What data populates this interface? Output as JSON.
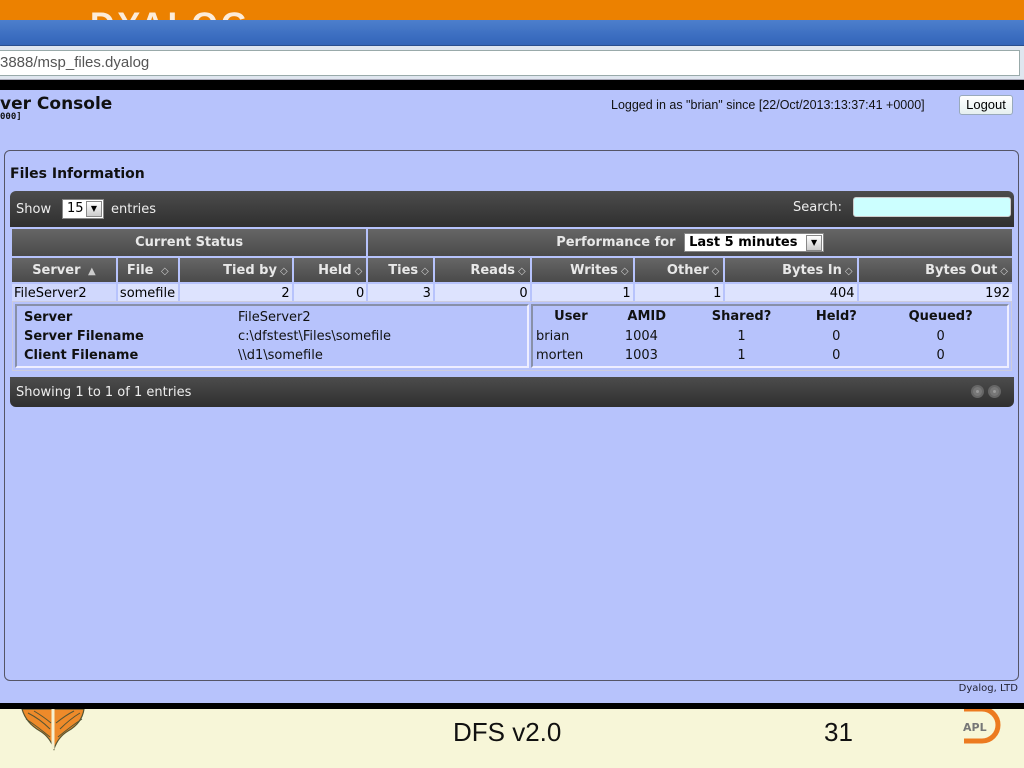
{
  "slide": {
    "brand": "DYALOG",
    "footer_title": "DFS v2.0",
    "page_number": "31",
    "apl_logo_text": "APL",
    "colors": {
      "banner": "#ec8100",
      "footer_bg": "#f7f6d8"
    }
  },
  "browser": {
    "address": "3888/msp_files.dyalog"
  },
  "page": {
    "title": "ver Console",
    "subtitle": "000]",
    "login_info": "Logged in as \"brian\" since [22/Oct/2013:13:37:41 +0000]",
    "logout_label": "Logout",
    "credits": "Dyalog, LTD",
    "background": "#b7c3fc"
  },
  "files_panel": {
    "title": "Files Information",
    "show_label": "Show",
    "page_length": "15",
    "entries_label": "entries",
    "search_label": "Search:",
    "search_value": "",
    "group_headers": {
      "current_status": "Current Status",
      "performance_for": "Performance for",
      "performance_period": "Last 5 minutes"
    },
    "columns": [
      {
        "label": "Server",
        "sort": "▲"
      },
      {
        "label": "File",
        "sort": "◇"
      },
      {
        "label": "Tied by",
        "sort": "◇"
      },
      {
        "label": "Held",
        "sort": "◇"
      },
      {
        "label": "Ties",
        "sort": "◇"
      },
      {
        "label": "Reads",
        "sort": "◇"
      },
      {
        "label": "Writes",
        "sort": "◇"
      },
      {
        "label": "Other",
        "sort": "◇"
      },
      {
        "label": "Bytes In",
        "sort": "◇"
      },
      {
        "label": "Bytes Out",
        "sort": "◇"
      }
    ],
    "rows": [
      {
        "server": "FileServer2",
        "file": "somefile",
        "tied_by": "2",
        "held": "0",
        "ties": "3",
        "reads": "0",
        "writes": "1",
        "other": "1",
        "bytes_in": "404",
        "bytes_out": "192"
      }
    ],
    "details": {
      "fields": [
        {
          "key": "Server",
          "value": "FileServer2"
        },
        {
          "key": "Server Filename",
          "value": "c:\\dfstest\\Files\\somefile"
        },
        {
          "key": "Client Filename",
          "value": "\\\\d1\\somefile"
        }
      ],
      "user_headers": [
        "User",
        "AMID",
        "Shared?",
        "Held?",
        "Queued?"
      ],
      "users": [
        [
          "brian",
          "1004",
          "1",
          "0",
          "0"
        ],
        [
          "morten",
          "1003",
          "1",
          "0",
          "0"
        ]
      ]
    },
    "info": "Showing 1 to 1 of 1 entries"
  }
}
